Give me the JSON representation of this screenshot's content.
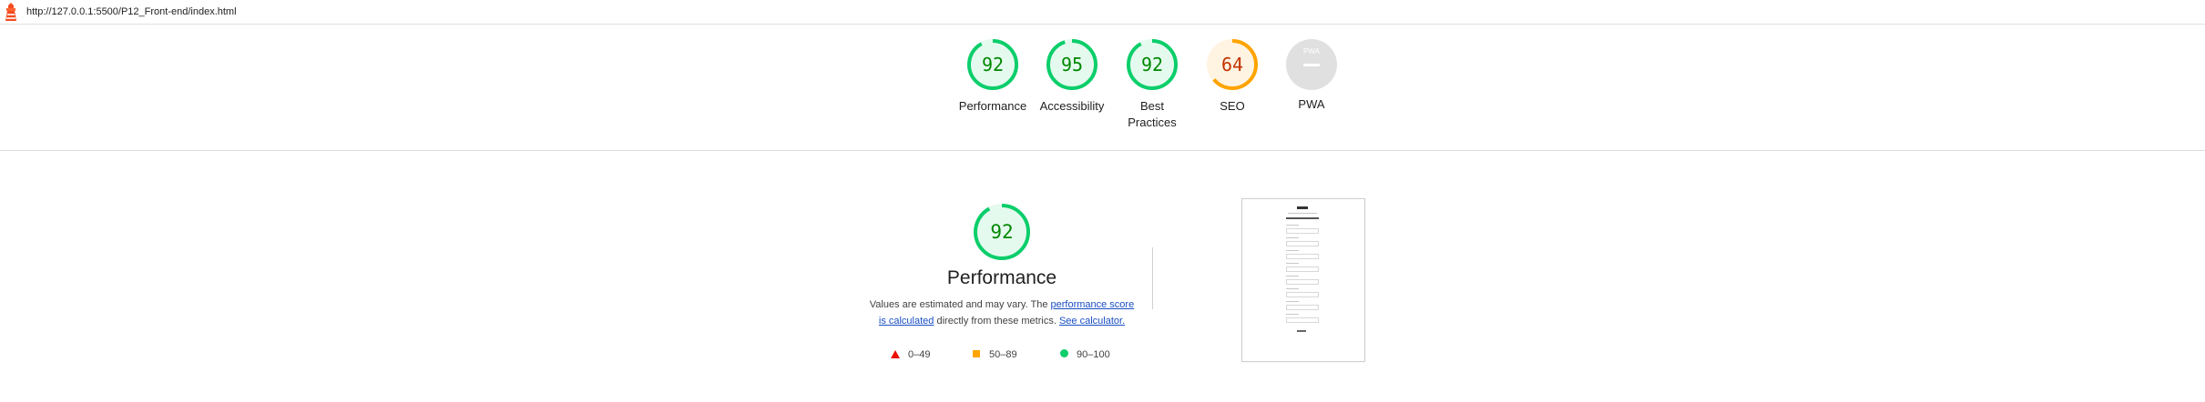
{
  "header": {
    "url": "http://127.0.0.1:5500/P12_Front-end/index.html"
  },
  "gauges": [
    {
      "label": "Performance",
      "score": "92",
      "value": 0.92,
      "color": "#0cce6b"
    },
    {
      "label": "Accessibility",
      "score": "95",
      "value": 0.95,
      "color": "#0cce6b"
    },
    {
      "label": "Best Practices",
      "score": "92",
      "value": 0.92,
      "color": "#0cce6b"
    },
    {
      "label": "SEO",
      "score": "64",
      "value": 0.64,
      "color": "#ffa400"
    },
    {
      "label": "PWA",
      "badge": "PWA",
      "score": ""
    }
  ],
  "performance": {
    "score": "92",
    "value": 0.92,
    "title": "Performance",
    "desc_prefix": "Values are estimated and may vary. The ",
    "link_score": "performance score is calculated",
    "desc_middle": " directly from these metrics. ",
    "link_calc": "See calculator."
  },
  "legend": {
    "fail": "0–49",
    "average": "50–89",
    "pass": "90–100"
  },
  "colors": {
    "pass": "#0cce6b",
    "average": "#ffa400",
    "fail": "#eb0f00",
    "pass_text": "#008800",
    "average_text": "#c33300"
  }
}
